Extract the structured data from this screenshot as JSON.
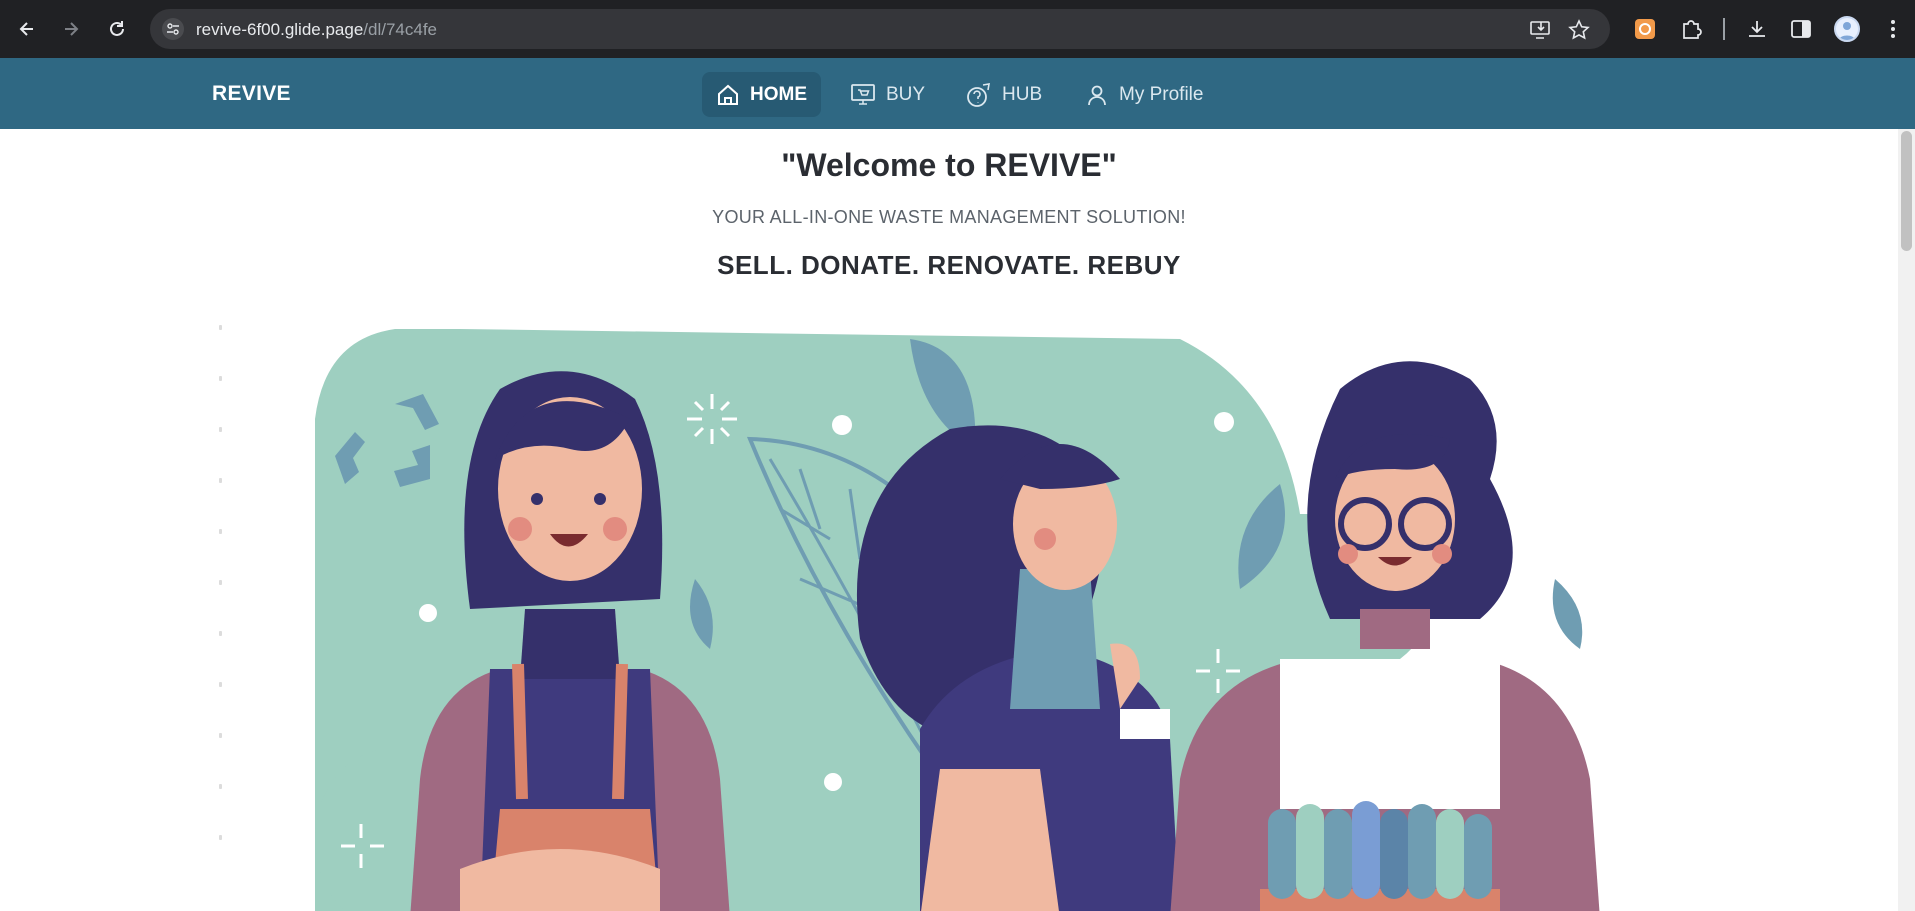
{
  "browser": {
    "url_host": "revive-6f00.glide.page",
    "url_path": "/dl/74c4fe",
    "icons": [
      "back-icon",
      "forward-icon",
      "reload-icon",
      "site-settings-icon",
      "install-app-icon",
      "bookmark-star-icon",
      "extension-icon",
      "puzzle-extensions-icon",
      "download-icon",
      "side-panel-icon",
      "profile-avatar",
      "more-menu-icon"
    ]
  },
  "app": {
    "brand": "REVIVE",
    "nav": [
      {
        "label": "HOME",
        "icon": "home-icon",
        "active": true
      },
      {
        "label": "BUY",
        "icon": "shop-monitor-icon",
        "active": false
      },
      {
        "label": "HUB",
        "icon": "help-rocket-icon",
        "active": false
      },
      {
        "label": "My Profile",
        "icon": "user-icon",
        "active": false
      }
    ]
  },
  "main": {
    "welcome": "\"Welcome to REVIVE\"",
    "tagline": "YOUR ALL-IN-ONE WASTE MANAGEMENT SOLUTION!",
    "motto": "SELL. DONATE. RENOVATE. REBUY",
    "hero_image": "three-people-recycling-illustration"
  },
  "colors": {
    "header_bg": "#2f6883",
    "active_nav_bg": "#275a73",
    "chrome_bg": "#202124",
    "illustration_teal": "#9ecfc0",
    "illustration_navy": "#35306b"
  }
}
